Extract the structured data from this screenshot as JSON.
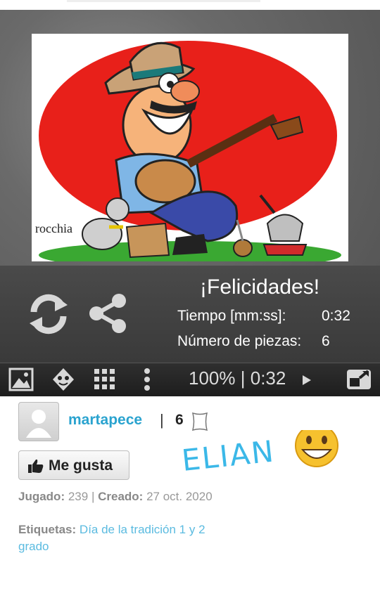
{
  "result": {
    "title": "¡Felicidades!",
    "time_label": "Tiempo [mm:ss]:",
    "time_value": "0:32",
    "pieces_label": "Número de piezas:",
    "pieces_value": "6"
  },
  "image": {
    "signature": "rocchia"
  },
  "toolbar": {
    "zoom": "100%",
    "divider": "|",
    "timer": "0:32"
  },
  "owner": {
    "username": "martapece",
    "divider": "|",
    "piece_count": "6"
  },
  "like_button": {
    "label": "Me gusta"
  },
  "meta": {
    "played_label": "Jugado:",
    "played_value": "239",
    "divider": "|",
    "created_label": "Creado:",
    "created_value": "27 oct. 2020",
    "tags_label": "Etiquetas:",
    "tags_value": "Día de la tradición 1 y 2 grado"
  },
  "comment": {
    "handwritten": "ELIAN"
  },
  "colors": {
    "link": "#2aa3cf",
    "panel": "#444444",
    "puzzle_red": "#e8201a",
    "grass": "#3aa832"
  }
}
